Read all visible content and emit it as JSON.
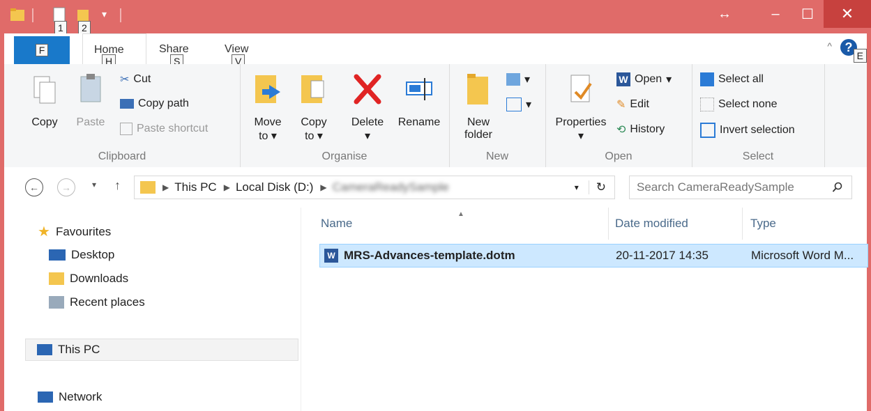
{
  "window": {
    "qat_keytips": [
      "1",
      "2"
    ],
    "tab_keytips": {
      "home": "H",
      "share": "S",
      "view": "V",
      "help": "E"
    }
  },
  "tabs": {
    "file": "F",
    "home": "Home",
    "share": "Share",
    "view": "View"
  },
  "ribbon": {
    "clipboard": {
      "label": "Clipboard",
      "copy": "Copy",
      "paste": "Paste",
      "cut": "Cut",
      "copy_path": "Copy path",
      "paste_shortcut": "Paste shortcut"
    },
    "organise": {
      "label": "Organise",
      "move_to_1": "Move",
      "move_to_2": "to",
      "copy_to_1": "Copy",
      "copy_to_2": "to",
      "delete": "Delete",
      "rename": "Rename"
    },
    "new": {
      "label": "New",
      "new_folder_1": "New",
      "new_folder_2": "folder"
    },
    "open": {
      "label": "Open",
      "properties": "Properties",
      "open": "Open",
      "edit": "Edit",
      "history": "History"
    },
    "select": {
      "label": "Select",
      "select_all": "Select all",
      "select_none": "Select none",
      "invert": "Invert selection"
    }
  },
  "address": {
    "crumbs": [
      "This PC",
      "Local Disk (D:)",
      "CameraReadySample"
    ],
    "search_placeholder": "Search CameraReadySample"
  },
  "nav": {
    "favourites": "Favourites",
    "desktop": "Desktop",
    "downloads": "Downloads",
    "recent": "Recent places",
    "this_pc": "This PC",
    "network": "Network"
  },
  "columns": {
    "name": "Name",
    "date": "Date modified",
    "type": "Type"
  },
  "files": [
    {
      "name": "MRS-Advances-template.dotm",
      "date": "20-11-2017 14:35",
      "type": "Microsoft Word M..."
    }
  ],
  "colors": {
    "titlebar": "#e06b69",
    "close": "#c7413e",
    "file_tab": "#1979ca",
    "selection": "#cde8ff"
  }
}
